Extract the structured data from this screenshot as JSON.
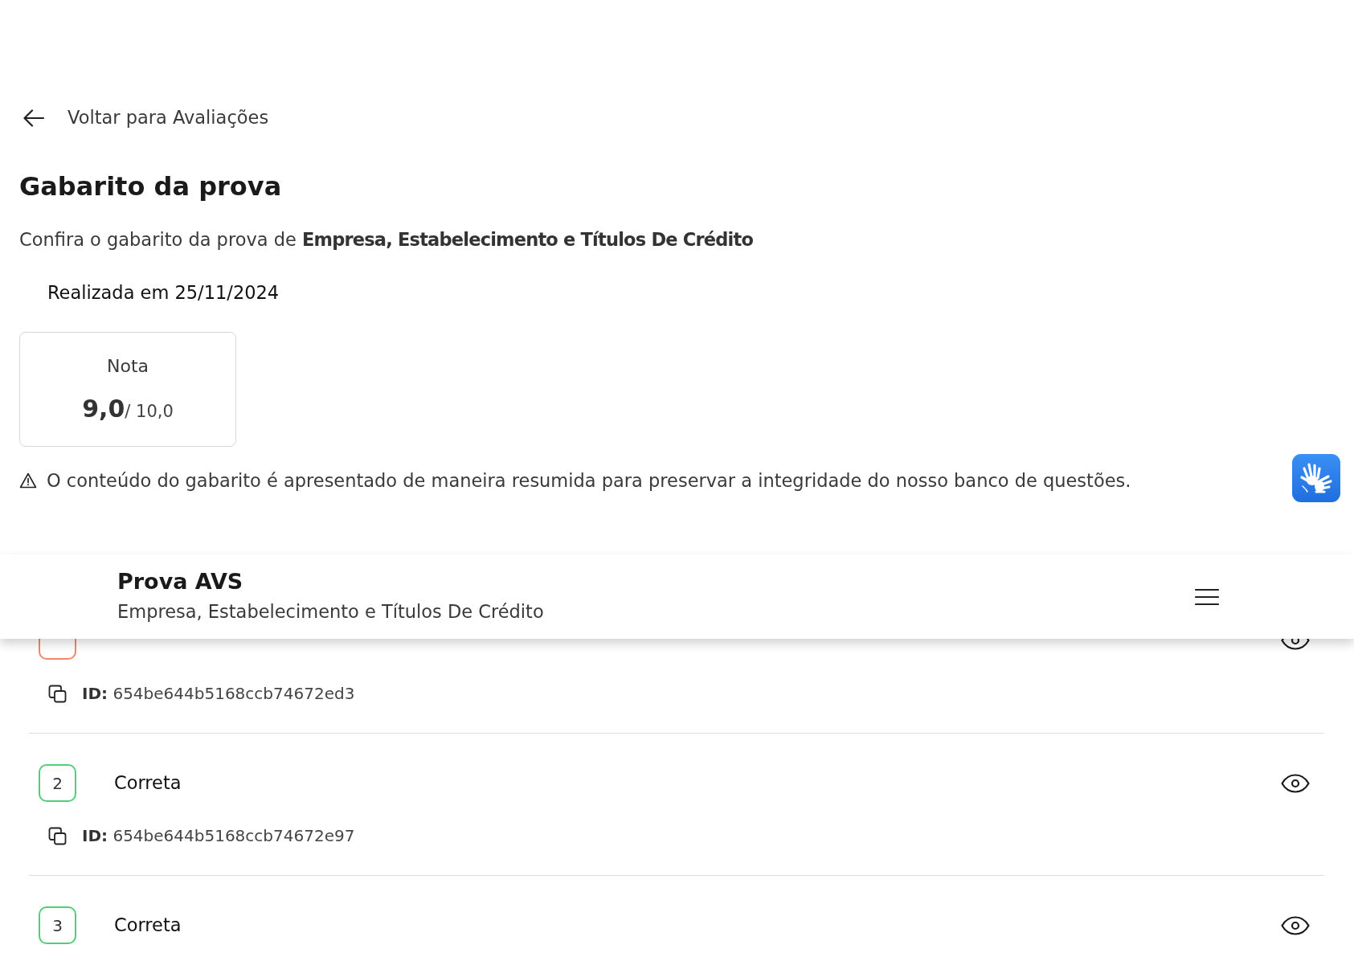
{
  "back_link": {
    "label": "Voltar para Avaliações"
  },
  "title": "Gabarito da prova",
  "subtitle": "Confira o gabarito da prova de **Empresa, Estabelecimento e Títulos De Crédito**",
  "date": "Realizada em 25/11/2024",
  "grade_card": {
    "label": "Nota",
    "score": "9,0",
    "max": "/ 10,0"
  },
  "notice": "O conteúdo do gabarito é apresentado de maneira resumida para preservar a integridade do nosso banco de questões.",
  "table": {
    "rows": [
      {
        "color": "#f5866c",
        "id_label": "ID:",
        "id": "654be644b5168ccb74672ed3"
      },
      {
        "number": "2",
        "result": "Correta",
        "color": "#4fcf78",
        "id_label": "ID:",
        "id": "654be644b5168ccb74672e97"
      },
      {
        "number": "3",
        "result": "Correta",
        "color": "#4fcf78"
      }
    ]
  },
  "exam_header": {
    "title": "Prova AVS",
    "subtitle": "Empresa, Estabelecimento e Títulos De Crédito"
  }
}
